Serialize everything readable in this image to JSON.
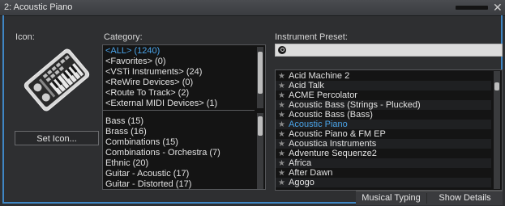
{
  "window": {
    "title": "2: Acoustic Piano"
  },
  "icon_panel": {
    "label": "Icon:",
    "set_icon_button": "Set Icon..."
  },
  "category": {
    "label": "Category:",
    "top_items": [
      {
        "label": "<ALL> (1240)",
        "selected": true
      },
      {
        "label": "<Favorites> (0)"
      },
      {
        "label": "<VSTi Instruments> (24)"
      },
      {
        "label": "<ReWire Devices> (0)"
      },
      {
        "label": "<Route To Track> (2)"
      },
      {
        "label": "<External MIDI Devices> (1)"
      }
    ],
    "items": [
      {
        "label": "Bass (15)"
      },
      {
        "label": "Brass (16)"
      },
      {
        "label": "Combinations (15)"
      },
      {
        "label": "Combinations - Orchestra (7)"
      },
      {
        "label": "Ethnic (20)"
      },
      {
        "label": "Guitar - Acoustic (17)"
      },
      {
        "label": "Guitar - Distorted (17)"
      }
    ]
  },
  "preset": {
    "label": "Instrument Preset:",
    "search": {
      "value": "",
      "placeholder": ""
    },
    "items": [
      {
        "label": "Acid Machine 2"
      },
      {
        "label": "Acid Talk"
      },
      {
        "label": "ACME Percolator"
      },
      {
        "label": "Acoustic Bass (Strings - Plucked)"
      },
      {
        "label": "Acoustic Bass (Bass)"
      },
      {
        "label": "Acoustic Piano",
        "selected": true
      },
      {
        "label": "Acoustic Piano & FM EP"
      },
      {
        "label": "Acoustica Instruments"
      },
      {
        "label": "Adventure Sequenze2"
      },
      {
        "label": "Africa"
      },
      {
        "label": "After Dawn"
      },
      {
        "label": "Agogo"
      }
    ]
  },
  "tabs": {
    "musical_typing": "Musical Typing",
    "show_details": "Show Details"
  },
  "colors": {
    "accent": "#3f86c4",
    "selected_text": "#4aa3e8",
    "background": "#2e2f31"
  }
}
